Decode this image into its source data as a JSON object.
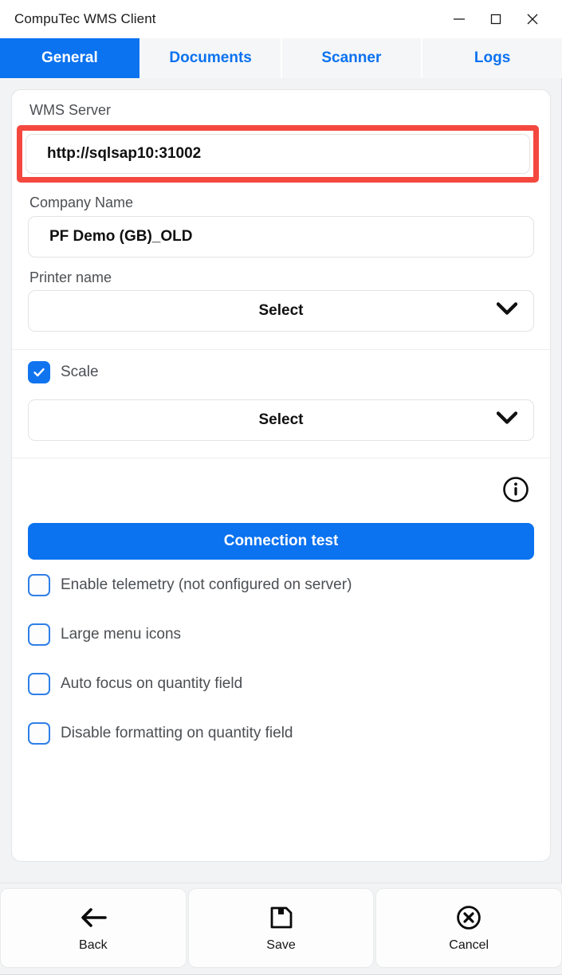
{
  "window": {
    "title": "CompuTec WMS Client",
    "controls": [
      {
        "name": "minimize",
        "glyph": "minimize-icon"
      },
      {
        "name": "maximize",
        "glyph": "maximize-icon"
      },
      {
        "name": "close",
        "glyph": "close-icon"
      }
    ]
  },
  "tabs": [
    {
      "label": "General",
      "active": true
    },
    {
      "label": "Documents",
      "active": false
    },
    {
      "label": "Scanner",
      "active": false
    },
    {
      "label": "Logs",
      "active": false
    }
  ],
  "form": {
    "wms_server": {
      "label": "WMS Server",
      "value": "http://sqlsap10:31002",
      "placeholder": "",
      "highlighted": true
    },
    "company_name": {
      "label": "Company Name",
      "value": "PF Demo (GB)_OLD",
      "placeholder": ""
    },
    "printer_name": {
      "label": "Printer name",
      "value": "Select",
      "options": [
        "Select"
      ]
    },
    "scale": {
      "label": "Scale",
      "checked": true,
      "select_value": "Select",
      "options": [
        "Select"
      ]
    },
    "info_icon": "info-icon",
    "connection_test": {
      "label": "Connection test"
    },
    "options": [
      {
        "label": "Enable telemetry (not configured on server)",
        "checked": false
      },
      {
        "label": "Large menu icons",
        "checked": false
      },
      {
        "label": "Auto focus on quantity field",
        "checked": false
      },
      {
        "label": "Disable formatting on quantity field",
        "checked": false
      }
    ]
  },
  "bottom_bar": [
    {
      "label": "Back",
      "icon": "arrow-left-icon"
    },
    {
      "label": "Save",
      "icon": "floppy-disk-icon"
    },
    {
      "label": "Cancel",
      "icon": "circle-x-icon"
    }
  ],
  "colors": {
    "accent": "#0b72f0",
    "highlight": "#f4483f",
    "tab_inactive_bg": "#f5f6f7",
    "page_bg": "#f1f3f4",
    "label_text": "#4c4f53"
  }
}
